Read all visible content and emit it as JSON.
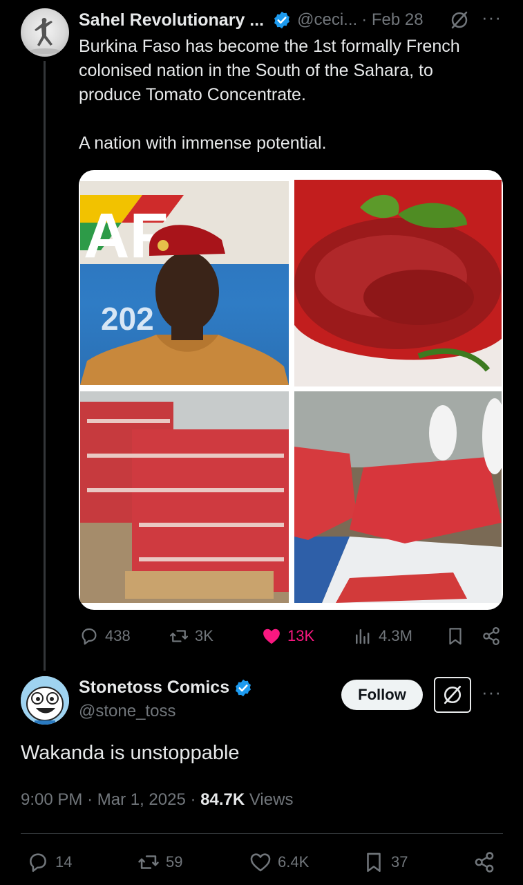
{
  "tweet": {
    "author_name": "Sahel Revolutionary ...",
    "author_handle": "@ceci...",
    "date": "· Feb 28",
    "text_lines": [
      "Burkina Faso has become the 1st formally French",
      "colonised nation in the South of the Sahara, to",
      "produce Tomato Concentrate."
    ],
    "text_line2": "A nation with immense potential.",
    "media_text": {
      "banner": "AF",
      "year": "202"
    },
    "stats": {
      "replies": "438",
      "reposts": "3K",
      "likes": "13K",
      "views": "4.3M"
    },
    "icons": [
      "verified-badge-icon",
      "grok-icon",
      "more-icon",
      "reply-icon",
      "repost-icon",
      "heart-icon",
      "views-icon",
      "bookmark-icon",
      "share-icon"
    ]
  },
  "reply": {
    "author_name": "Stonetoss Comics",
    "author_handle": "@stone_toss",
    "follow_label": "Follow",
    "text": "Wakanda is unstoppable",
    "time": "9:00 PM",
    "date": "· Mar 1, 2025 ·",
    "views_count": "84.7K",
    "views_label": "Views",
    "stats": {
      "replies": "14",
      "reposts": "59",
      "likes": "6.4K",
      "bookmarks": "37"
    }
  },
  "colors": {
    "background": "#000000",
    "text_primary": "#e7e9ea",
    "text_secondary": "#71767b",
    "like_pink": "#f91880",
    "verified_blue": "#1d9bf0",
    "divider": "#2f3336"
  }
}
